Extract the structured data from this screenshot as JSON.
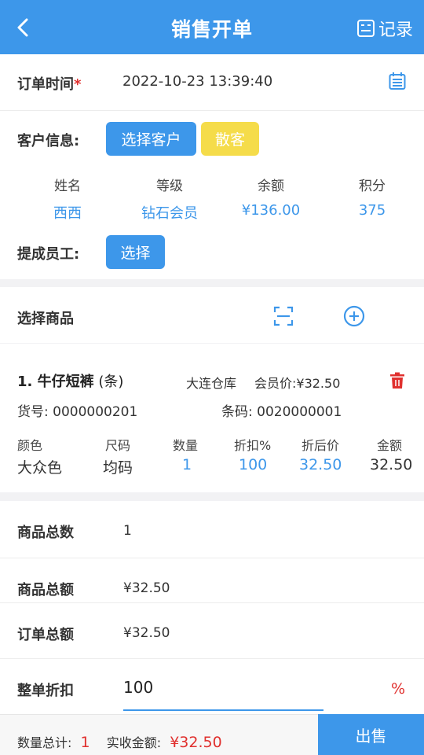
{
  "header": {
    "title": "销售开单",
    "record_label": "记录"
  },
  "order_time": {
    "label": "订单时间",
    "required_mark": "*",
    "value": "2022-10-23 13:39:40"
  },
  "customer": {
    "label": "客户信息:",
    "select_button": "选择客户",
    "walkin_button": "散客",
    "columns": [
      "姓名",
      "等级",
      "余额",
      "积分"
    ],
    "values": [
      "西西",
      "钻石会员",
      "¥136.00",
      "375"
    ]
  },
  "staff": {
    "label": "提成员工:",
    "select_button": "选择"
  },
  "goods_section": {
    "label": "选择商品"
  },
  "goods": {
    "name": "1. 牛仔短裤",
    "unit": "(条)",
    "warehouse": "大连仓库",
    "member_price": "会员价:¥32.50",
    "sku_label": "货号:",
    "sku": "0000000201",
    "barcode_label": "条码:",
    "barcode": "0020000001",
    "columns": [
      "颜色",
      "尺码",
      "数量",
      "折扣%",
      "折后价",
      "金额"
    ],
    "values": [
      "大众色",
      "均码",
      "1",
      "100",
      "32.50",
      "32.50"
    ]
  },
  "summary": {
    "total_count_label": "商品总数",
    "total_count": "1",
    "goods_amount_label": "商品总额",
    "goods_amount": "¥32.50",
    "order_amount_label": "订单总额",
    "order_amount": "¥32.50",
    "discount_label": "整单折扣",
    "discount": "100",
    "discount_unit": "%"
  },
  "footer": {
    "qty_label": "数量总计:",
    "qty": "1",
    "paid_label": "实收金额:",
    "paid": "¥32.50",
    "sell_button": "出售"
  },
  "colors": {
    "primary": "#3d97ea",
    "accent_red": "#e0302e",
    "walkin_yellow": "#f5dc4a"
  }
}
